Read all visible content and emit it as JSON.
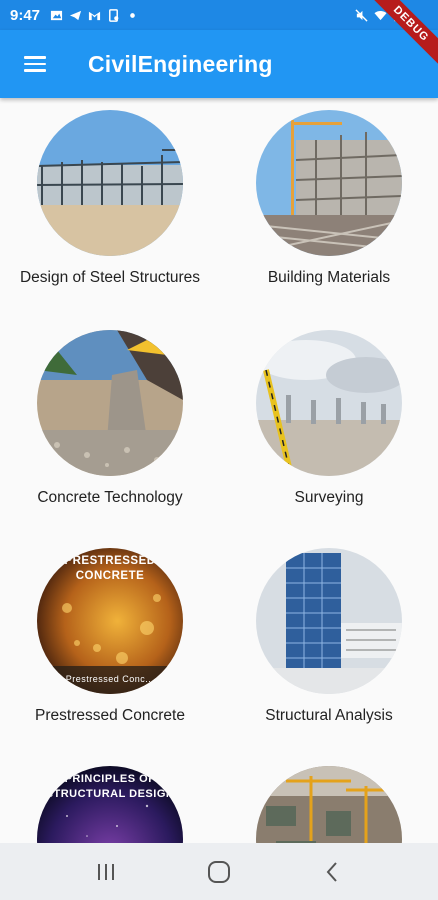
{
  "status_bar": {
    "time": "9:47"
  },
  "debug_banner": {
    "text": "DEBUG"
  },
  "app_bar": {
    "title": "CivilEngineering",
    "menu_icon": "hamburger-menu-icon"
  },
  "colors": {
    "app_bar": "#2196f3",
    "status_bar": "#1e88e5",
    "debug_ribbon": "#b71c1c"
  },
  "subjects": [
    {
      "label": "Design of Steel Structures",
      "image_text": ""
    },
    {
      "label": "Building Materials",
      "image_text": ""
    },
    {
      "label": "Concrete Technology",
      "image_text": ""
    },
    {
      "label": "Surveying",
      "image_text": ""
    },
    {
      "label": "Prestressed Concrete",
      "image_text": "PRESTRESSED CONCRETE",
      "image_caption": "Prestressed Conc..."
    },
    {
      "label": "Structural Analysis",
      "image_text": ""
    },
    {
      "label": "",
      "image_text": "PRINCIPLES OF STRUCTURAL DESIGN"
    },
    {
      "label": "",
      "image_text": ""
    }
  ],
  "nav_bar": {
    "recents_icon": "recents-icon",
    "home_icon": "home-icon",
    "back_icon": "back-icon"
  }
}
